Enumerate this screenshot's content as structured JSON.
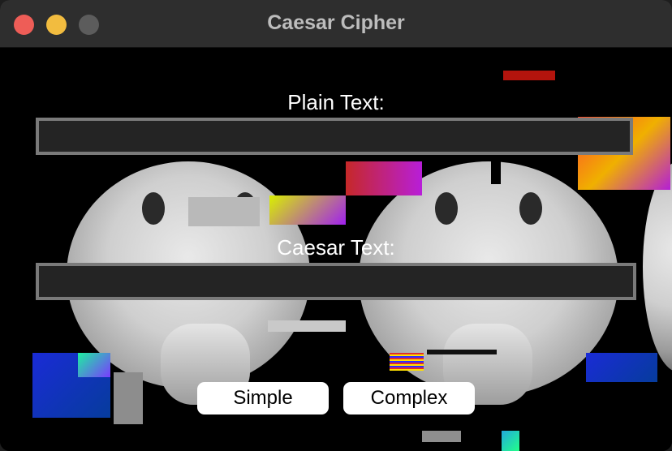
{
  "window": {
    "title": "Caesar Cipher"
  },
  "labels": {
    "plain": "Plain Text:",
    "caesar": "Caesar Text:"
  },
  "inputs": {
    "plain_value": "",
    "caesar_value": ""
  },
  "buttons": {
    "simple": "Simple",
    "complex": "Complex"
  },
  "colors": {
    "close": "#ee5d57",
    "minimize": "#f2bc3f",
    "maximize": "#5c5c5c",
    "field_bg": "#242424",
    "field_border": "#7a7a7a"
  }
}
